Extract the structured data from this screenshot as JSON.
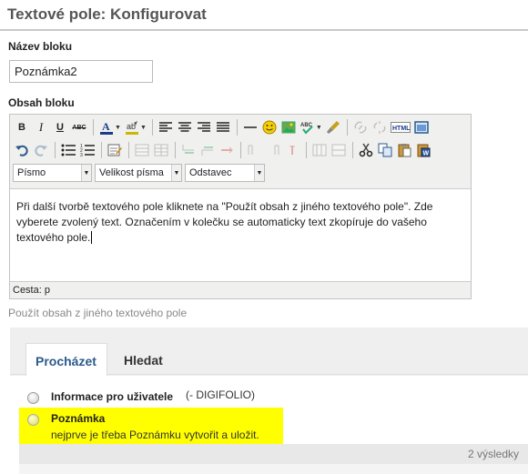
{
  "page": {
    "title": "Textové pole: Konfigurovat"
  },
  "form": {
    "name_label": "Název bloku",
    "name_value": "Poznámka2",
    "content_label": "Obsah bloku"
  },
  "toolbar": {
    "bold": "B",
    "italic": "I",
    "underline": "U",
    "strike": "ABC",
    "font_select": "Písmo",
    "size_select": "Velikost písma",
    "format_select": "Odstavec"
  },
  "editor": {
    "content": "Při další tvorbě textového pole kliknete na \"Použít obsah z jiného textového pole\". Zde vyberete zvolený text. Označením v kolečku se automaticky text zkopíruje do vašeho textového pole.",
    "path": "Cesta: p"
  },
  "use_other_link": "Použít obsah z jiného textového pole",
  "browser": {
    "tabs": [
      "Procházet",
      "Hledat"
    ],
    "results": [
      {
        "title": "Informace pro uživatele",
        "owner": "(- DIGIFOLIO)"
      },
      {
        "title": "Poznámka",
        "description": "nejprve je třeba Poznámku vytvořit a uložit."
      }
    ],
    "count": "2 výsledky"
  },
  "colors": {
    "accent": "#2c5a8c",
    "highlight": "#ffff00",
    "title": "#555555"
  }
}
